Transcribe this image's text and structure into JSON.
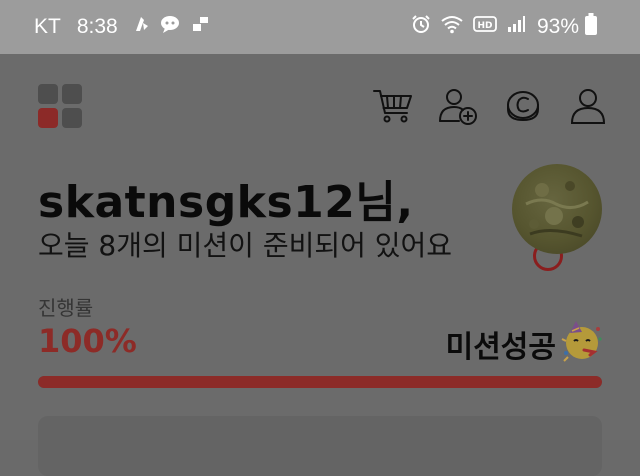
{
  "status_bar": {
    "carrier": "KT",
    "time": "8:38",
    "battery": "93%",
    "icons": [
      "notification-icon",
      "chat-icon",
      "tile-icon",
      "alarm-icon",
      "wifi-icon",
      "hd-icon",
      "signal-icon",
      "battery-icon"
    ]
  },
  "header": {
    "icons": [
      "grid-menu-icon",
      "cart-icon",
      "add-friend-icon",
      "coin-icon",
      "profile-icon"
    ]
  },
  "greeting": {
    "name": "skatnsgks12님,",
    "subtitle": "오늘 8개의 미션이 준비되어 있어요"
  },
  "progress": {
    "label": "진행률",
    "value_text": "100%",
    "value": 100,
    "status": "미션성공",
    "status_icon": "party-face-icon"
  },
  "colors": {
    "accent": "#8c2b28",
    "statusbar": "#9c9c9c",
    "background": "#6b6b6b"
  }
}
